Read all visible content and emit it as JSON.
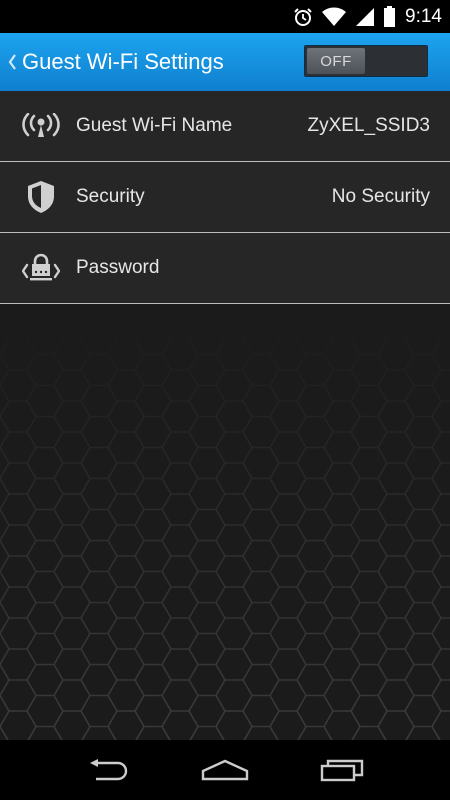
{
  "status_bar": {
    "time": "9:14",
    "icons": [
      "alarm-icon",
      "wifi-icon",
      "signal-icon",
      "battery-icon"
    ]
  },
  "header": {
    "back_icon": "chevron-left-icon",
    "title": "Guest Wi-Fi Settings",
    "toggle_label": "OFF",
    "toggle_state": "off"
  },
  "settings": {
    "items": [
      {
        "icon": "wifi-broadcast-icon",
        "label": "Guest Wi-Fi Name",
        "value": "ZyXEL_SSID3"
      },
      {
        "icon": "shield-icon",
        "label": "Security",
        "value": "No Security"
      },
      {
        "icon": "lock-icon",
        "label": "Password",
        "value": ""
      }
    ]
  },
  "nav_bar": {
    "icons": [
      "back-icon",
      "home-icon",
      "recent-apps-icon"
    ]
  },
  "colors": {
    "accent": "#1792df",
    "row_bg": "#262626",
    "divider": "#bdbdbd"
  }
}
